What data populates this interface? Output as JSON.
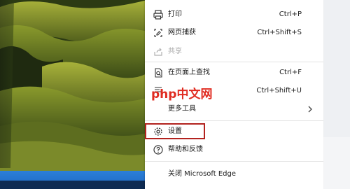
{
  "menu": {
    "items": [
      {
        "label": "打印",
        "shortcut": "Ctrl+P",
        "icon": "printer-icon"
      },
      {
        "label": "网页捕获",
        "shortcut": "Ctrl+Shift+S",
        "icon": "web-capture-icon"
      },
      {
        "label": "共享",
        "shortcut": "",
        "icon": "share-icon"
      },
      {
        "label": "在页面上查找",
        "shortcut": "Ctrl+F",
        "icon": "find-on-page-icon"
      },
      {
        "label": "大声朗读",
        "shortcut": "Ctrl+Shift+U",
        "icon": "read-aloud-icon"
      },
      {
        "label": "更多工具",
        "shortcut": "",
        "icon": ""
      },
      {
        "label": "设置",
        "shortcut": "",
        "icon": "gear-icon"
      },
      {
        "label": "帮助和反馈",
        "shortcut": "",
        "icon": "help-icon"
      },
      {
        "label": "关闭 Microsoft Edge",
        "shortcut": "",
        "icon": ""
      }
    ]
  },
  "watermark": {
    "text": "php中文网"
  },
  "colors": {
    "highlight": "#b3231f",
    "watermark": "#e02b20"
  }
}
